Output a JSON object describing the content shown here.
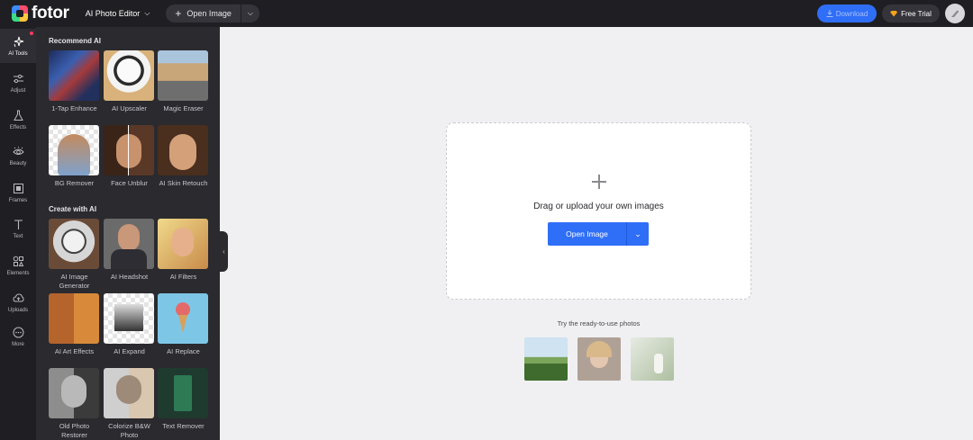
{
  "app": {
    "logo_text": "fotor"
  },
  "header": {
    "editor_mode": "AI Photo Editor",
    "open_image_label": "Open Image",
    "download_label": "Download",
    "free_trial_label": "Free Trial"
  },
  "rail": {
    "items": [
      {
        "label": "AI Tools",
        "icon": "sparkles-icon"
      },
      {
        "label": "Adjust",
        "icon": "sliders-icon"
      },
      {
        "label": "Effects",
        "icon": "flask-icon"
      },
      {
        "label": "Beauty",
        "icon": "eye-icon"
      },
      {
        "label": "Frames",
        "icon": "frame-icon"
      },
      {
        "label": "Text",
        "icon": "text-icon"
      },
      {
        "label": "Elements",
        "icon": "shapes-icon"
      },
      {
        "label": "Uploads",
        "icon": "cloud-upload-icon"
      },
      {
        "label": "More",
        "icon": "more-icon"
      }
    ]
  },
  "panel": {
    "recommend_title": "Recommend AI",
    "create_title": "Create with AI",
    "recommend": [
      {
        "label": "1-Tap Enhance"
      },
      {
        "label": "AI Upscaler"
      },
      {
        "label": "Magic Eraser"
      },
      {
        "label": "BG Remover"
      },
      {
        "label": "Face Unblur"
      },
      {
        "label": "AI Skin Retouch"
      }
    ],
    "create": [
      {
        "label": "AI Image Generator"
      },
      {
        "label": "AI Headshot"
      },
      {
        "label": "AI Filters"
      },
      {
        "label": "AI Art Effects"
      },
      {
        "label": "AI Expand"
      },
      {
        "label": "AI Replace"
      },
      {
        "label": "Old Photo Restorer"
      },
      {
        "label": "Colorize B&W Photo"
      },
      {
        "label": "Text Remover"
      }
    ]
  },
  "canvas": {
    "drag_text": "Drag or upload your own images",
    "open_image_label": "Open Image",
    "try_text": "Try the ready-to-use photos"
  },
  "colors": {
    "accent": "#2f6ef6",
    "dark_bg": "#1f1f23",
    "panel_bg": "#2a2a2f"
  }
}
